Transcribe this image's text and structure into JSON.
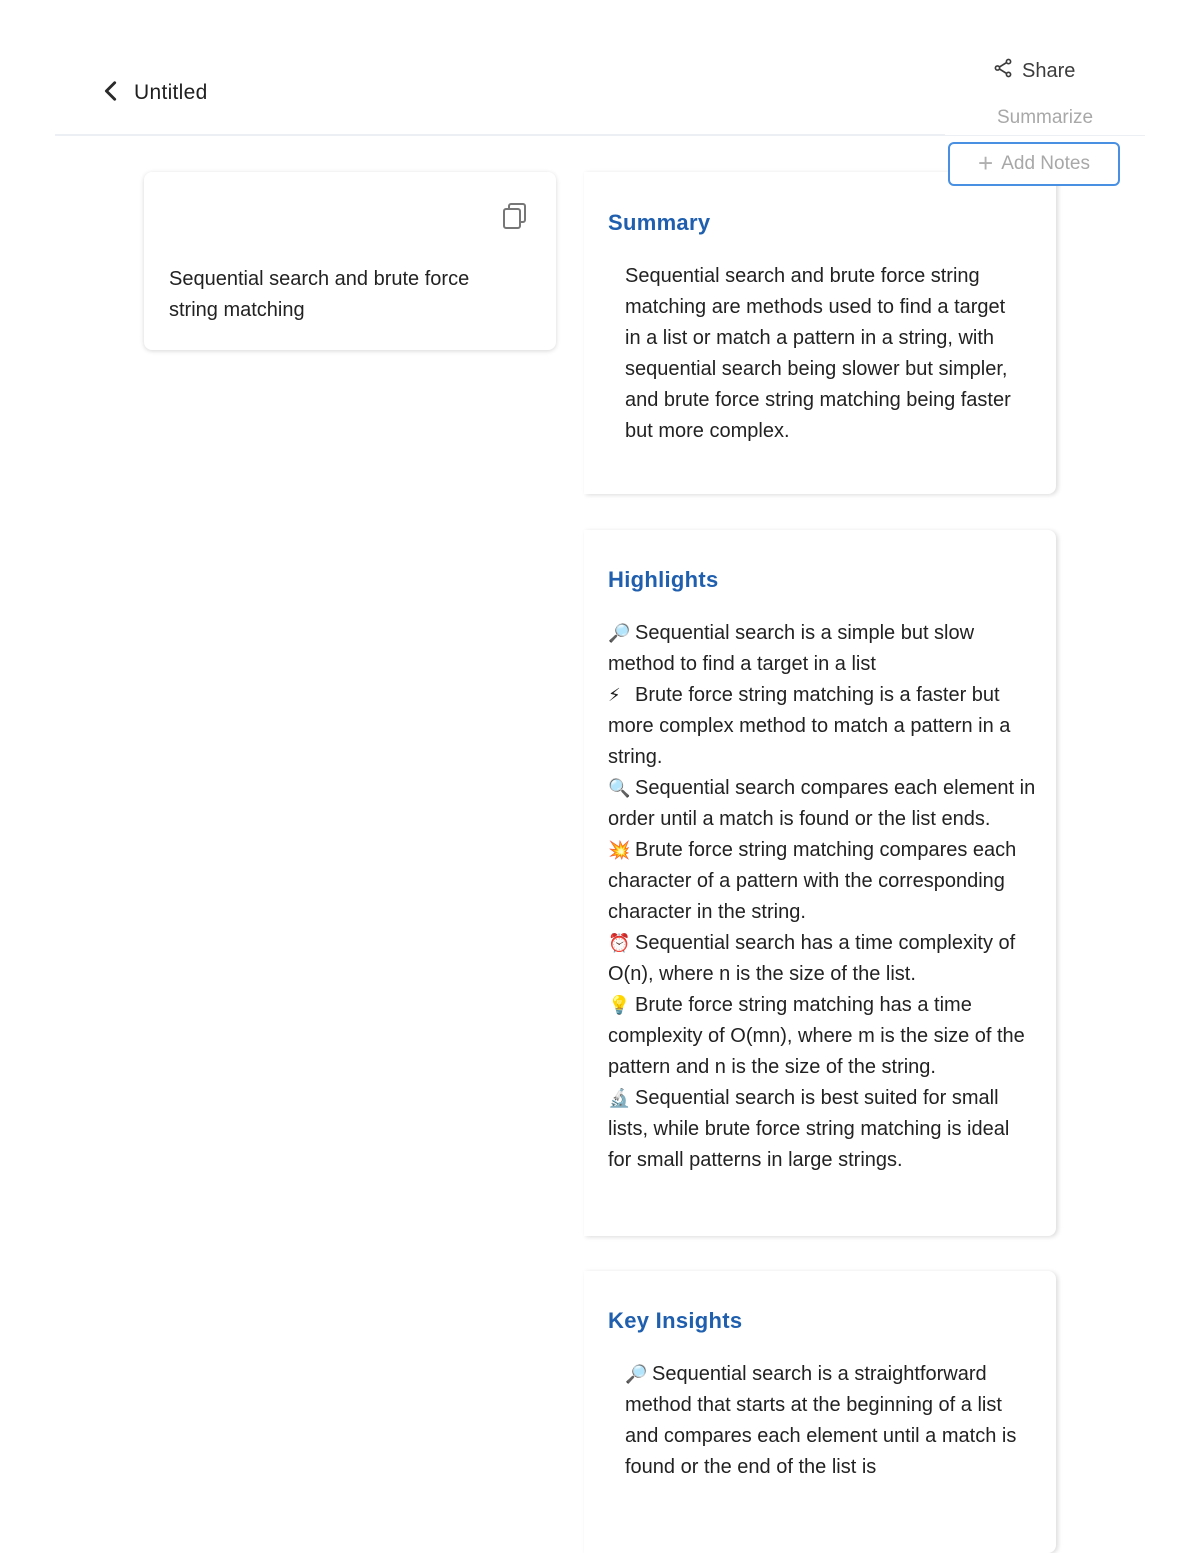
{
  "header": {
    "title": "Untitled",
    "share_label": "Share",
    "summarize_label": "Summarize",
    "add_notes_label": "Add Notes"
  },
  "note": {
    "text": "Sequential search and brute force string matching"
  },
  "summary": {
    "title": "Summary",
    "text": "Sequential search and brute force string matching are methods used to find a target in a list or match a pattern in a string, with sequential search being slower but simpler, and brute force string matching being faster but more complex."
  },
  "highlights": {
    "title": "Highlights",
    "items": [
      {
        "emoji": "🔎",
        "text": "Sequential search is a simple but slow method to find a target in a list"
      },
      {
        "emoji": "⚡",
        "text": "Brute force string matching is a faster but more complex method to match a pattern in a string."
      },
      {
        "emoji": "🔍",
        "text": "Sequential search compares each element in order until a match is found or the list ends."
      },
      {
        "emoji": "💥",
        "text": "Brute force string matching compares each character of a pattern with the corresponding character in the string."
      },
      {
        "emoji": "⏰",
        "text": "Sequential search has a time complexity of O(n), where n is the size of the list."
      },
      {
        "emoji": "💡",
        "text": "Brute force string matching has a time complexity of O(mn), where m is the size of the pattern and n is the size of the string."
      },
      {
        "emoji": "🔬",
        "text": "Sequential search is best suited for small lists, while brute force string matching is ideal for small patterns in large strings."
      }
    ]
  },
  "insights": {
    "title": "Key Insights",
    "items": [
      {
        "emoji": "🔎",
        "text": "Sequential search is a straightforward method that starts at the beginning of a list and compares each element until a match is found or the end of the list is"
      }
    ]
  },
  "colors": {
    "section_title": "#1f5fae",
    "add_notes_border": "#4a90e2",
    "muted_text": "#a8a8a8"
  },
  "icons": {
    "back": "chevron-left-icon",
    "share": "share-icon",
    "add": "plus-icon",
    "copy": "copy-icon"
  }
}
